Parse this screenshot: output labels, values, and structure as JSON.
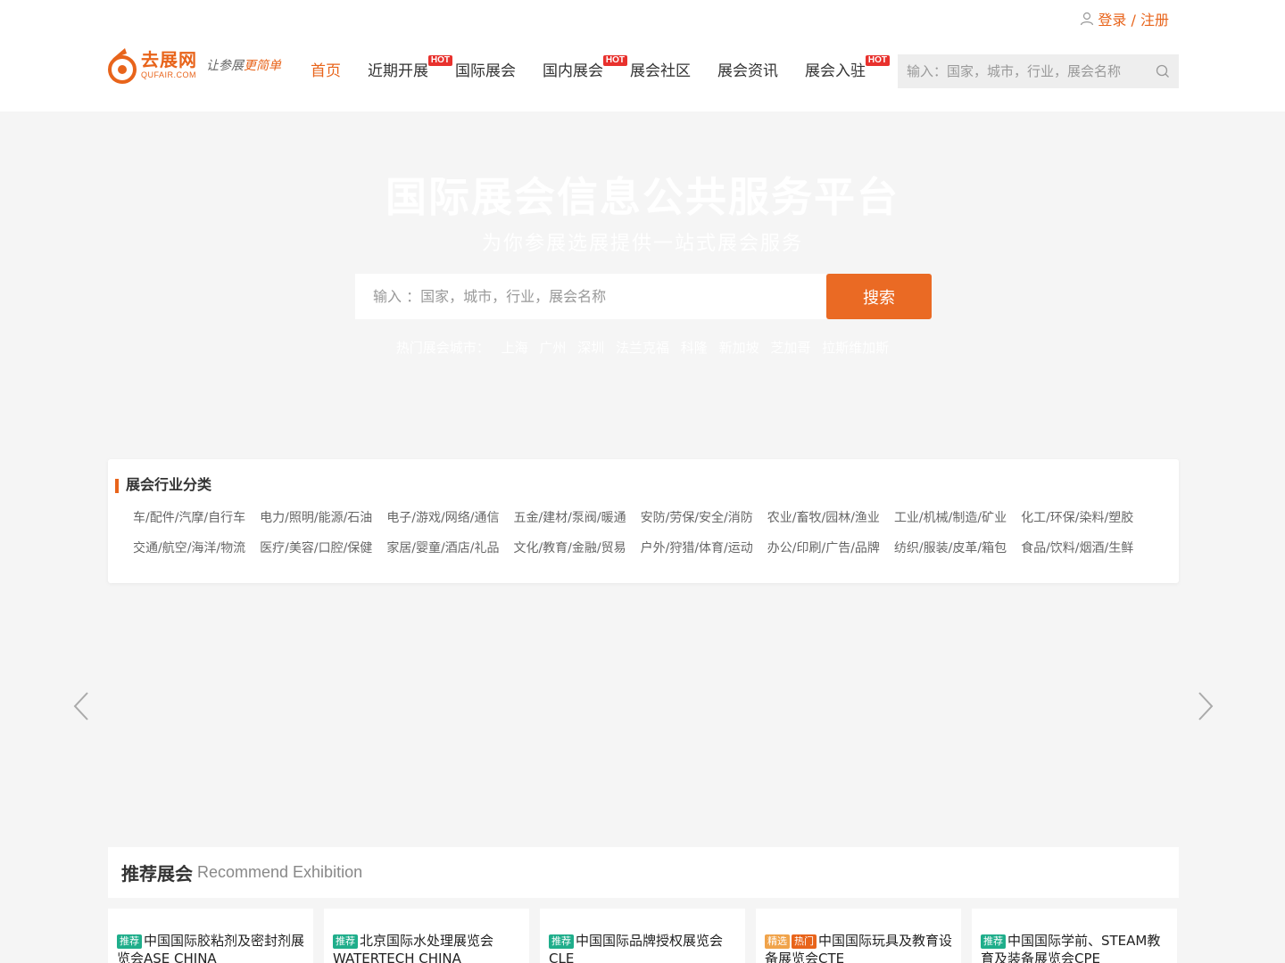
{
  "header": {
    "login_label": "登录 / 注册",
    "logo_cn": "去展网",
    "logo_en": "QUFAIR.COM",
    "slogan_a": "让参展",
    "slogan_b": "更简单",
    "nav": [
      {
        "label": "首页",
        "hot": false,
        "active": true
      },
      {
        "label": "近期开展",
        "hot": true
      },
      {
        "label": "国际展会",
        "hot": false
      },
      {
        "label": "国内展会",
        "hot": true
      },
      {
        "label": "展会社区",
        "hot": false
      },
      {
        "label": "展会资讯",
        "hot": false
      },
      {
        "label": "展会入驻",
        "hot": true
      }
    ],
    "hot_badge": "HOT",
    "search_placeholder": "输入：国家，城市，行业，展会名称"
  },
  "hero": {
    "title": "国际展会信息公共服务平台",
    "subtitle": "为你参展选展提供一站式展会服务",
    "search_placeholder": "输入 ：国家，城市，行业，展会名称",
    "search_button": "搜索",
    "hot_cities_label": "热门展会城市：",
    "hot_cities": [
      "上海",
      "广州",
      "深圳",
      "法兰克福",
      "科隆",
      "新加坡",
      "芝加哥",
      "拉斯维加斯"
    ]
  },
  "categories": {
    "title": "展会行业分类",
    "items": [
      "车/配件/汽摩/自行车",
      "电力/照明/能源/石油",
      "电子/游戏/网络/通信",
      "五金/建材/泵阀/暖通",
      "安防/劳保/安全/消防",
      "农业/畜牧/园林/渔业",
      "工业/机械/制造/矿业",
      "化工/环保/染料/塑胶",
      "交通/航空/海洋/物流",
      "医疗/美容/口腔/保健",
      "家居/婴童/酒店/礼品",
      "文化/教育/金融/贸易",
      "户外/狩猎/体育/运动",
      "办公/印刷/广告/品牌",
      "纺织/服装/皮革/箱包",
      "食品/饮料/烟酒/生鲜"
    ]
  },
  "recommend": {
    "title_cn": "推荐展会",
    "title_en": "Recommend Exhibition",
    "cards": [
      {
        "tags": [
          "推荐"
        ],
        "title": "中国国际胶粘剂及密封剂展览会ASE CHINA"
      },
      {
        "tags": [
          "推荐"
        ],
        "title": "北京国际水处理展览会WATERTECH CHINA"
      },
      {
        "tags": [
          "推荐"
        ],
        "title": "中国国际品牌授权展览会CLE"
      },
      {
        "tags": [
          "精选",
          "热门"
        ],
        "title": "中国国际玩具及教育设备展览会CTE"
      },
      {
        "tags": [
          "推荐"
        ],
        "title": "中国国际学前、STEAM教育及装备展览会CPE"
      }
    ]
  },
  "colors": {
    "accent": "#e8641b",
    "hot_badge": "#e8312d",
    "tag_recommend": "#1fae8b"
  }
}
